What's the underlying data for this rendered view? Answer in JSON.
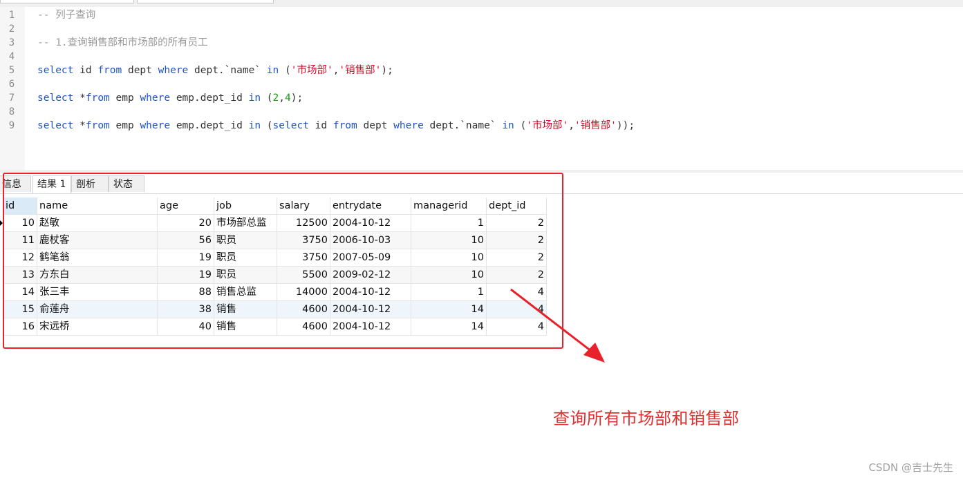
{
  "editor": {
    "lines": [
      {
        "n": "1",
        "parts": [
          {
            "t": "-- 列子查询",
            "c": "cm"
          }
        ]
      },
      {
        "n": "2",
        "parts": []
      },
      {
        "n": "3",
        "parts": [
          {
            "t": "-- 1.查询销售部和市场部的所有员工",
            "c": "cm"
          }
        ]
      },
      {
        "n": "4",
        "parts": []
      },
      {
        "n": "5",
        "parts": [
          {
            "t": "select",
            "c": "kw"
          },
          {
            "t": " id ",
            "c": ""
          },
          {
            "t": "from",
            "c": "kw"
          },
          {
            "t": " dept ",
            "c": ""
          },
          {
            "t": "where",
            "c": "kw"
          },
          {
            "t": " dept.`name` ",
            "c": ""
          },
          {
            "t": "in",
            "c": "kw"
          },
          {
            "t": " (",
            "c": ""
          },
          {
            "t": "'市场部'",
            "c": "st"
          },
          {
            "t": ",",
            "c": ""
          },
          {
            "t": "'销售部'",
            "c": "st"
          },
          {
            "t": ");",
            "c": ""
          }
        ]
      },
      {
        "n": "6",
        "parts": []
      },
      {
        "n": "7",
        "parts": [
          {
            "t": "select",
            "c": "kw"
          },
          {
            "t": " *",
            "c": ""
          },
          {
            "t": "from",
            "c": "kw"
          },
          {
            "t": " emp ",
            "c": ""
          },
          {
            "t": "where",
            "c": "kw"
          },
          {
            "t": " emp.dept_id ",
            "c": ""
          },
          {
            "t": "in",
            "c": "kw"
          },
          {
            "t": " (",
            "c": ""
          },
          {
            "t": "2",
            "c": "nm"
          },
          {
            "t": ",",
            "c": ""
          },
          {
            "t": "4",
            "c": "nm"
          },
          {
            "t": ");",
            "c": ""
          }
        ]
      },
      {
        "n": "8",
        "parts": []
      },
      {
        "n": "9",
        "parts": [
          {
            "t": "select",
            "c": "kw"
          },
          {
            "t": " *",
            "c": ""
          },
          {
            "t": "from",
            "c": "kw"
          },
          {
            "t": " emp ",
            "c": ""
          },
          {
            "t": "where",
            "c": "kw"
          },
          {
            "t": " emp.dept_id ",
            "c": ""
          },
          {
            "t": "in",
            "c": "kw"
          },
          {
            "t": " (",
            "c": ""
          },
          {
            "t": "select",
            "c": "kw"
          },
          {
            "t": " id ",
            "c": ""
          },
          {
            "t": "from",
            "c": "kw"
          },
          {
            "t": " dept ",
            "c": ""
          },
          {
            "t": "where",
            "c": "kw"
          },
          {
            "t": " dept.`name` ",
            "c": ""
          },
          {
            "t": "in",
            "c": "kw"
          },
          {
            "t": " (",
            "c": ""
          },
          {
            "t": "'市场部'",
            "c": "st"
          },
          {
            "t": ",",
            "c": ""
          },
          {
            "t": "'销售部'",
            "c": "st"
          },
          {
            "t": "));",
            "c": ""
          }
        ]
      }
    ]
  },
  "result_tabs": [
    {
      "label": "信息",
      "active": false
    },
    {
      "label": "结果 1",
      "active": true
    },
    {
      "label": "剖析",
      "active": false
    },
    {
      "label": "状态",
      "active": false
    }
  ],
  "table": {
    "columns": [
      "id",
      "name",
      "age",
      "job",
      "salary",
      "entrydate",
      "managerid",
      "dept_id"
    ],
    "rows": [
      [
        "10",
        "赵敏",
        "20",
        "市场部总监",
        "12500",
        "2004-10-12",
        "1",
        "2"
      ],
      [
        "11",
        "鹿杖客",
        "56",
        "职员",
        "3750",
        "2006-10-03",
        "10",
        "2"
      ],
      [
        "12",
        "鹤笔翁",
        "19",
        "职员",
        "3750",
        "2007-05-09",
        "10",
        "2"
      ],
      [
        "13",
        "方东白",
        "19",
        "职员",
        "5500",
        "2009-02-12",
        "10",
        "2"
      ],
      [
        "14",
        "张三丰",
        "88",
        "销售总监",
        "14000",
        "2004-10-12",
        "1",
        "4"
      ],
      [
        "15",
        "俞莲舟",
        "38",
        "销售",
        "4600",
        "2004-10-12",
        "14",
        "4"
      ],
      [
        "16",
        "宋远桥",
        "40",
        "销售",
        "4600",
        "2004-10-12",
        "14",
        "4"
      ]
    ]
  },
  "annotation": {
    "text": "查询所有市场部和销售部",
    "color": "#e23030"
  },
  "watermark": "CSDN @吉士先生"
}
